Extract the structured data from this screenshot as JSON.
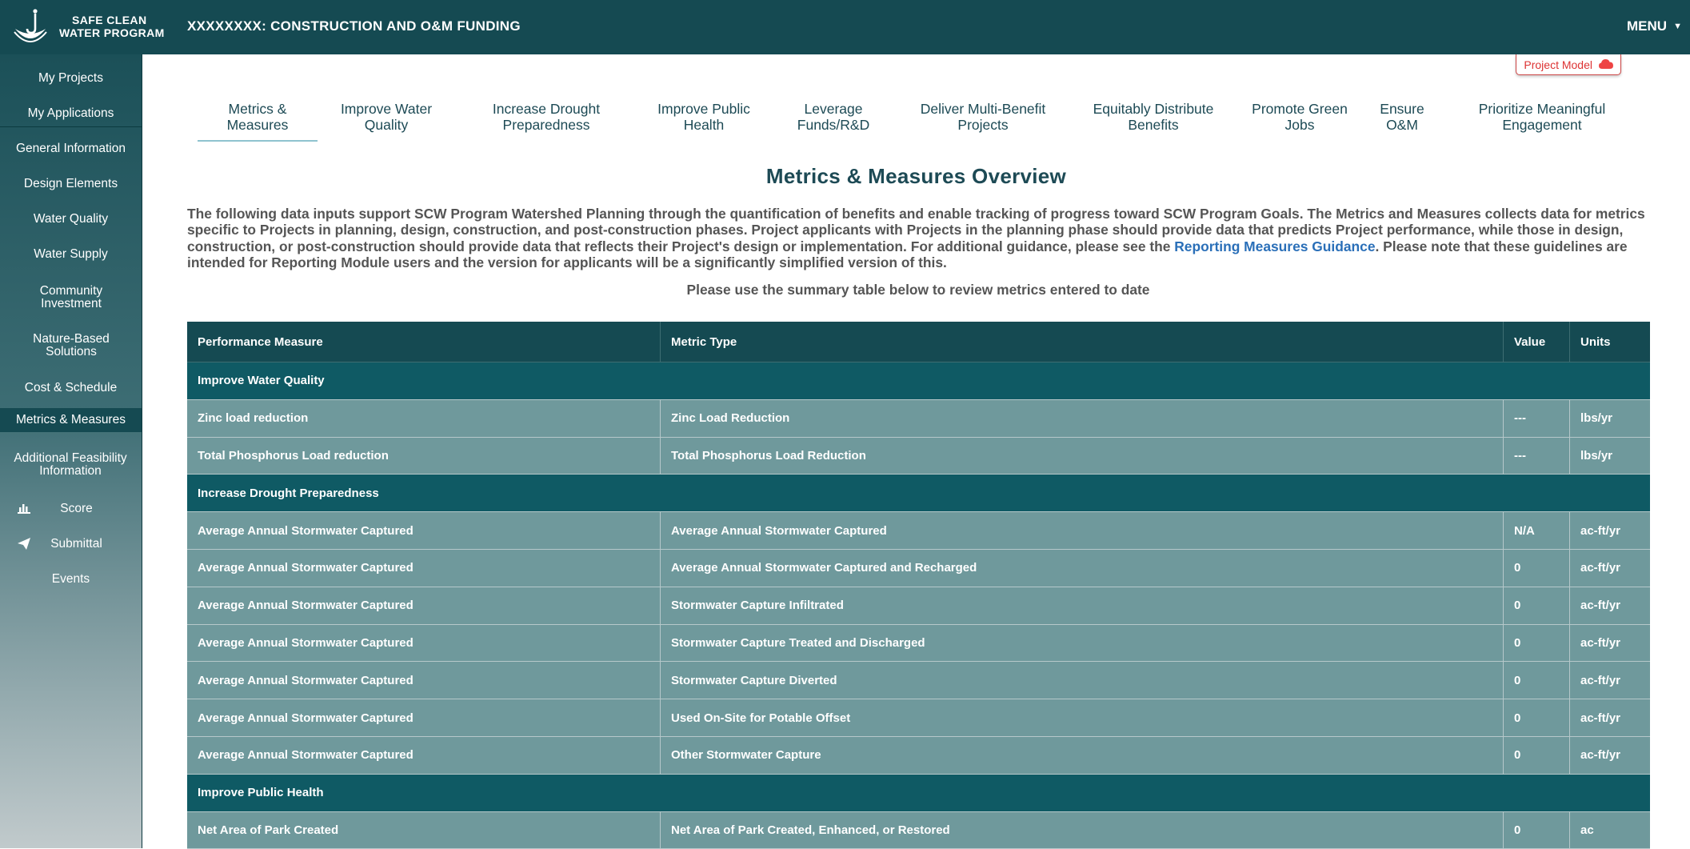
{
  "header": {
    "logo_line1": "SAFE CLEAN",
    "logo_line2": "WATER PROGRAM",
    "title": "XXXXXXXX:  CONSTRUCTION AND O&M FUNDING",
    "menu_label": "MENU"
  },
  "sidebar": {
    "items": [
      {
        "label": "My Projects"
      },
      {
        "label": "My Applications"
      },
      {
        "label": "General Information"
      },
      {
        "label": "Design Elements"
      },
      {
        "label": "Water Quality"
      },
      {
        "label": "Water Supply"
      },
      {
        "label": "Community Investment"
      },
      {
        "label": "Nature-Based Solutions"
      },
      {
        "label": "Cost & Schedule"
      },
      {
        "label": "Metrics & Measures"
      },
      {
        "label": "Additional Feasibility Information"
      },
      {
        "label": "Score"
      },
      {
        "label": "Submittal"
      },
      {
        "label": "Events"
      }
    ]
  },
  "project_model_label": "Project Model",
  "tabs": [
    {
      "line1": "Metrics &",
      "line2": "Measures"
    },
    {
      "line1": "Improve Water",
      "line2": "Quality"
    },
    {
      "line1": "Increase Drought",
      "line2": "Preparedness"
    },
    {
      "line1": "Improve Public",
      "line2": "Health"
    },
    {
      "line1": "Leverage",
      "line2": "Funds/R&D"
    },
    {
      "line1": "Deliver Multi-Benefit",
      "line2": "Projects"
    },
    {
      "line1": "Equitably Distribute",
      "line2": "Benefits"
    },
    {
      "line1": "Promote Green",
      "line2": "Jobs"
    },
    {
      "line1": "Ensure",
      "line2": "O&M"
    },
    {
      "line1": "Prioritize Meaningful",
      "line2": "Engagement"
    }
  ],
  "overview": {
    "title": "Metrics & Measures Overview",
    "intro_before_link": "The following data inputs support SCW Program Watershed Planning through the quantification of benefits and enable tracking of progress toward SCW Program Goals. The Metrics and Measures collects data for metrics specific to Projects in planning, design, construction, and post-construction phases. Project applicants with Projects in the planning phase should provide data that predicts Project performance, while those in design, construction, or post-construction should provide data that reflects their Project's design or implementation. For additional guidance, please see the ",
    "link_text": "Reporting Measures Guidance",
    "intro_after_link": ". Please note that these guidelines are intended for Reporting Module users and the version for applicants will be a significantly simplified version of this.",
    "review_note": "Please use the summary table below to review metrics entered to date"
  },
  "table": {
    "headers": [
      "Performance Measure",
      "Metric Type",
      "Value",
      "Units"
    ],
    "rows": [
      {
        "group": "Improve Water Quality"
      },
      {
        "cells": [
          "Zinc load reduction",
          "Zinc Load Reduction",
          "---",
          "lbs/yr"
        ]
      },
      {
        "cells": [
          "Total Phosphorus Load reduction",
          "Total Phosphorus Load Reduction",
          "---",
          "lbs/yr"
        ]
      },
      {
        "group": "Increase Drought Preparedness"
      },
      {
        "cells": [
          "Average Annual Stormwater Captured",
          "Average Annual Stormwater Captured",
          "N/A",
          "ac-ft/yr"
        ]
      },
      {
        "cells": [
          "Average Annual Stormwater Captured",
          "Average Annual Stormwater Captured and Recharged",
          "0",
          "ac-ft/yr"
        ]
      },
      {
        "cells": [
          "Average Annual Stormwater Captured",
          "Stormwater Capture Infiltrated",
          "0",
          "ac-ft/yr"
        ]
      },
      {
        "cells": [
          "Average Annual Stormwater Captured",
          "Stormwater Capture Treated and Discharged",
          "0",
          "ac-ft/yr"
        ]
      },
      {
        "cells": [
          "Average Annual Stormwater Captured",
          "Stormwater Capture Diverted",
          "0",
          "ac-ft/yr"
        ]
      },
      {
        "cells": [
          "Average Annual Stormwater Captured",
          "Used On-Site for Potable Offset",
          "0",
          "ac-ft/yr"
        ]
      },
      {
        "cells": [
          "Average Annual Stormwater Captured",
          "Other Stormwater Capture",
          "0",
          "ac-ft/yr"
        ]
      },
      {
        "group": "Improve Public Health"
      },
      {
        "cells": [
          "Net Area of Park Created",
          "Net Area of Park Created, Enhanced, or Restored",
          "0",
          "ac"
        ]
      }
    ]
  },
  "colors": {
    "header_bg": "#154a52",
    "group_row": "#0f5a64",
    "data_row": "#6f999c",
    "link": "#2a6fb8",
    "title": "#1d4a55"
  }
}
